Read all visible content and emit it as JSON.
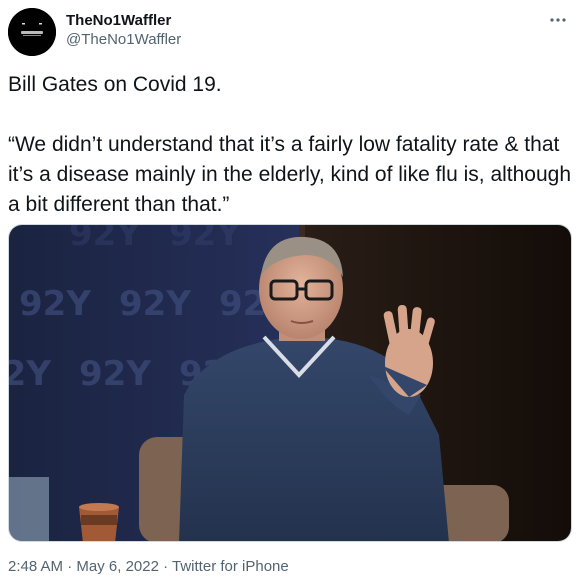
{
  "author": {
    "display_name": "TheNo1Waffler",
    "handle": "@TheNo1Waffler"
  },
  "tweet": {
    "line1": "Bill Gates on Covid 19.",
    "quote": "“We didn’t understand that it’s a fairly low fatality rate & that it’s a disease mainly in the elderly, kind of like flu is, although a bit different than that.”"
  },
  "media": {
    "backdrop_text": "92Y"
  },
  "meta": {
    "time": "2:48 AM",
    "separator1": " · ",
    "date": "May 6, 2022",
    "separator2": " · ",
    "source": "Twitter for iPhone"
  },
  "icons": {
    "more": "more-dots-icon"
  },
  "colors": {
    "text_primary": "#0f1419",
    "text_secondary": "#536471",
    "border": "#cfd9de"
  }
}
